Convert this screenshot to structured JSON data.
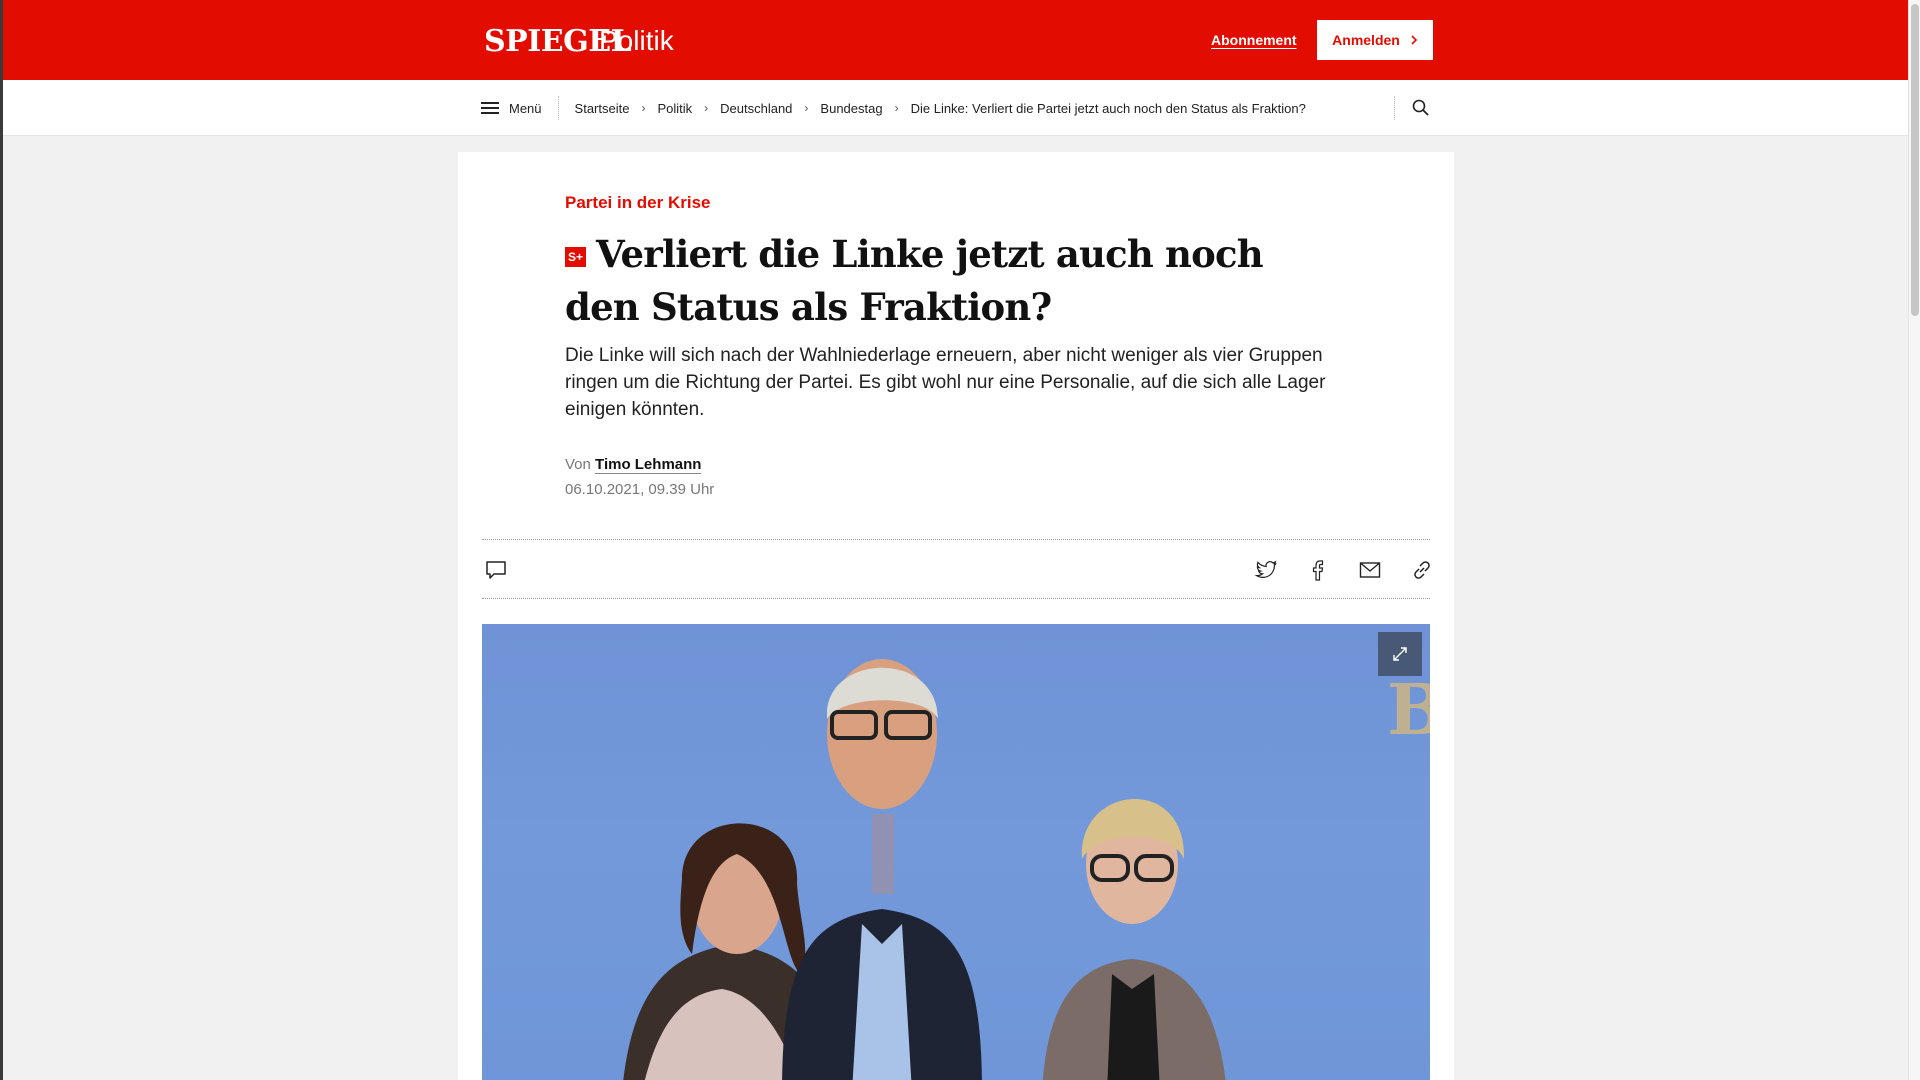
{
  "header": {
    "logo": "SPIEGEL",
    "ressort": "Politik",
    "abo_label": "Abonnement",
    "login_label": "Anmelden",
    "brand_color": "#e30c00"
  },
  "nav": {
    "menu_label": "Menü",
    "breadcrumbs": [
      "Startseite",
      "Politik",
      "Deutschland",
      "Bundestag",
      "Die Linke: Verliert die Partei jetzt auch noch den Status als Fraktion?"
    ],
    "search_icon": "search-icon"
  },
  "article": {
    "kicker": "Partei in der Krise",
    "badge": "S+",
    "headline": "Verliert die Linke jetzt auch noch den Status als Fraktion?",
    "teaser": "Die Linke will sich nach der Wahlniederlage erneuern, aber nicht weniger als vier Gruppen ringen um die Richtung der Partei. Es gibt wohl nur eine Personalie, auf die sich alle Lager einigen könnten.",
    "byline_prefix": "Von",
    "author": "Timo Lehmann",
    "date": "06.10.2021, 09.39 Uhr"
  },
  "share": {
    "icons": [
      "comment-icon",
      "twitter-icon",
      "facebook-icon",
      "mail-icon",
      "link-icon"
    ]
  },
  "hero": {
    "expand_icon": "expand-icon",
    "background_color": "#7399da"
  }
}
